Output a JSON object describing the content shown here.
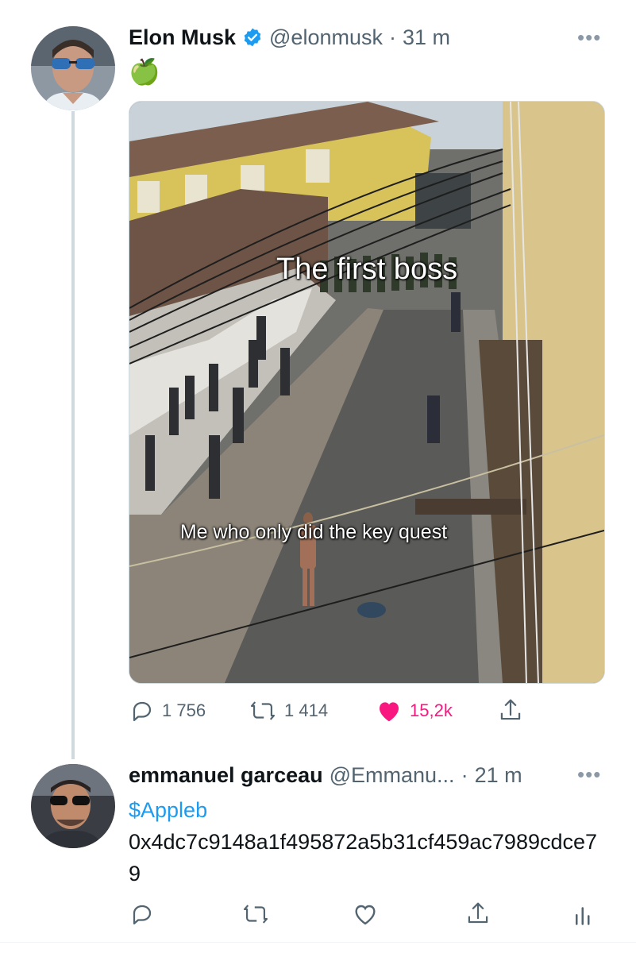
{
  "tweet1": {
    "author_name": "Elon Musk",
    "handle": "@elonmusk",
    "time": "31 m",
    "text": "🍏",
    "meme": {
      "top_caption": "The first boss",
      "bottom_caption": "Me who only did the key quest"
    },
    "actions": {
      "replies": "1 756",
      "retweets": "1 414",
      "likes": "15,2k"
    },
    "more": "•••"
  },
  "tweet2": {
    "author_name": "emmanuel garceau",
    "handle": "@Emmanu...",
    "time": "21 m",
    "cashtag": "$Appleb",
    "text": "0x4dc7c9148a1f495872a5b31cf459ac7989cdce79",
    "more": "•••"
  },
  "colors": {
    "link_blue": "#1d9bf0",
    "like_red": "#f91880",
    "muted": "#536471",
    "border": "#cfd9de"
  },
  "icons": [
    "reply-icon",
    "retweet-icon",
    "like-icon",
    "share-icon",
    "analytics-icon",
    "verified-icon",
    "more-icon"
  ]
}
